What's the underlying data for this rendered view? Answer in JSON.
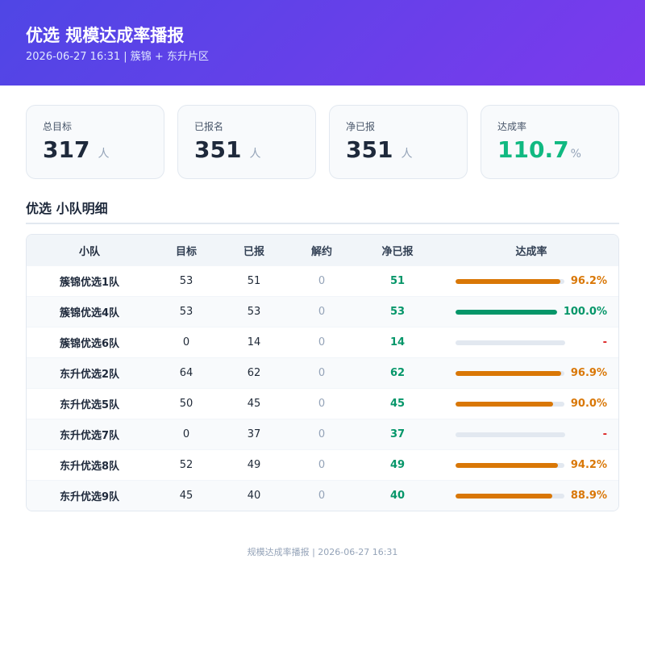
{
  "header": {
    "title": "优选 规模达成率播报",
    "subtitle": "2026-06-27 16:31 | 簇锦 + 东升片区"
  },
  "cards": [
    {
      "label": "总目标",
      "value": "317",
      "unit": "人"
    },
    {
      "label": "已报名",
      "value": "351",
      "unit": "人"
    },
    {
      "label": "净已报",
      "value": "351",
      "unit": "人"
    },
    {
      "label": "达成率",
      "value": "110.7",
      "unit": "%"
    }
  ],
  "section_title": "优选 小队明细",
  "table": {
    "headers": {
      "team": "小队",
      "target": "目标",
      "reported": "已报",
      "cancelled": "解约",
      "net": "净已报",
      "rate": "达成率"
    },
    "rows": [
      {
        "team": "簇锦优选1队",
        "target": "53",
        "reported": "51",
        "cancelled": "0",
        "net": "51",
        "rate_text": "96.2%",
        "rate": 96.2
      },
      {
        "team": "簇锦优选4队",
        "target": "53",
        "reported": "53",
        "cancelled": "0",
        "net": "53",
        "rate_text": "100.0%",
        "rate": 100.0
      },
      {
        "team": "簇锦优选6队",
        "target": "0",
        "reported": "14",
        "cancelled": "0",
        "net": "14",
        "rate_text": "-",
        "rate": null
      },
      {
        "team": "东升优选2队",
        "target": "64",
        "reported": "62",
        "cancelled": "0",
        "net": "62",
        "rate_text": "96.9%",
        "rate": 96.9
      },
      {
        "team": "东升优选5队",
        "target": "50",
        "reported": "45",
        "cancelled": "0",
        "net": "45",
        "rate_text": "90.0%",
        "rate": 90.0
      },
      {
        "team": "东升优选7队",
        "target": "0",
        "reported": "37",
        "cancelled": "0",
        "net": "37",
        "rate_text": "-",
        "rate": null
      },
      {
        "team": "东升优选8队",
        "target": "52",
        "reported": "49",
        "cancelled": "0",
        "net": "49",
        "rate_text": "94.2%",
        "rate": 94.2
      },
      {
        "team": "东升优选9队",
        "target": "45",
        "reported": "40",
        "cancelled": "0",
        "net": "40",
        "rate_text": "88.9%",
        "rate": 88.9
      }
    ]
  },
  "footer": "规模达成率播报 | 2026-06-27 16:31",
  "colors": {
    "header_start": "#4f46e5",
    "header_end": "#7c3aed",
    "rate_full": "#059669",
    "rate_partial": "#d97706",
    "rate_none": "#dc2626",
    "kpi_rate": "#10b981"
  }
}
